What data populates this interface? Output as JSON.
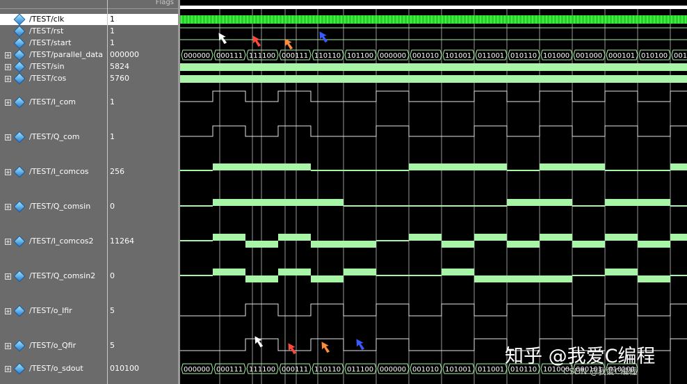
{
  "header": {
    "flags_label": "Flags"
  },
  "signals": [
    {
      "name": "/TEST/clk",
      "value": "1",
      "expandable": false,
      "selected": true
    },
    {
      "name": "/TEST/rst",
      "value": "1",
      "expandable": false,
      "selected": false
    },
    {
      "name": "/TEST/start",
      "value": "1",
      "expandable": false,
      "selected": false
    },
    {
      "name": "/TEST/parallel_data",
      "value": "000000",
      "expandable": true,
      "selected": false
    },
    {
      "name": "/TEST/sin",
      "value": "5824",
      "expandable": true,
      "selected": false
    },
    {
      "name": "/TEST/cos",
      "value": "5760",
      "expandable": true,
      "selected": false
    },
    {
      "name": "/TEST/I_com",
      "value": "1",
      "expandable": true,
      "selected": false
    },
    {
      "name": "/TEST/Q_com",
      "value": "1",
      "expandable": true,
      "selected": false
    },
    {
      "name": "/TEST/I_comcos",
      "value": "256",
      "expandable": true,
      "selected": false
    },
    {
      "name": "/TEST/Q_comsin",
      "value": "0",
      "expandable": true,
      "selected": false
    },
    {
      "name": "/TEST/I_comcos2",
      "value": "11264",
      "expandable": true,
      "selected": false
    },
    {
      "name": "/TEST/Q_comsin2",
      "value": "0",
      "expandable": true,
      "selected": false
    },
    {
      "name": "/TEST/o_Ifir",
      "value": "5",
      "expandable": true,
      "selected": false
    },
    {
      "name": "/TEST/o_Qfir",
      "value": "5",
      "expandable": true,
      "selected": false
    },
    {
      "name": "/TEST/o_sdout",
      "value": "010100",
      "expandable": true,
      "selected": false
    }
  ],
  "waves": {
    "parallel_data": [
      "000000",
      "000111",
      "111100",
      "000111",
      "110110",
      "101100",
      "000000",
      "001010",
      "101001",
      "011001",
      "010110",
      "101000",
      "001000",
      "000101",
      "010100",
      "001"
    ],
    "o_sdout": [
      "000000",
      "000111",
      "111100",
      "000111",
      "110110",
      "011100",
      "000000",
      "001010",
      "101001",
      "011001",
      "010110",
      "101000",
      "000101",
      "010100"
    ],
    "I_com": [
      0,
      1,
      0,
      1,
      0,
      0,
      1,
      0,
      0,
      1,
      0,
      1,
      0,
      1,
      0,
      1
    ],
    "Q_com": [
      0,
      1,
      0,
      1,
      0,
      0,
      1,
      0,
      0,
      1,
      0,
      1,
      0,
      1,
      0,
      1
    ]
  },
  "watermark": {
    "main": "知乎 @我爱C编程",
    "sub": "CSDN @我爱C编程"
  },
  "colors": {
    "wave": "#a8f5a8",
    "bus_fill": "#a8f5a8",
    "cursor": "#d9d9d9"
  }
}
